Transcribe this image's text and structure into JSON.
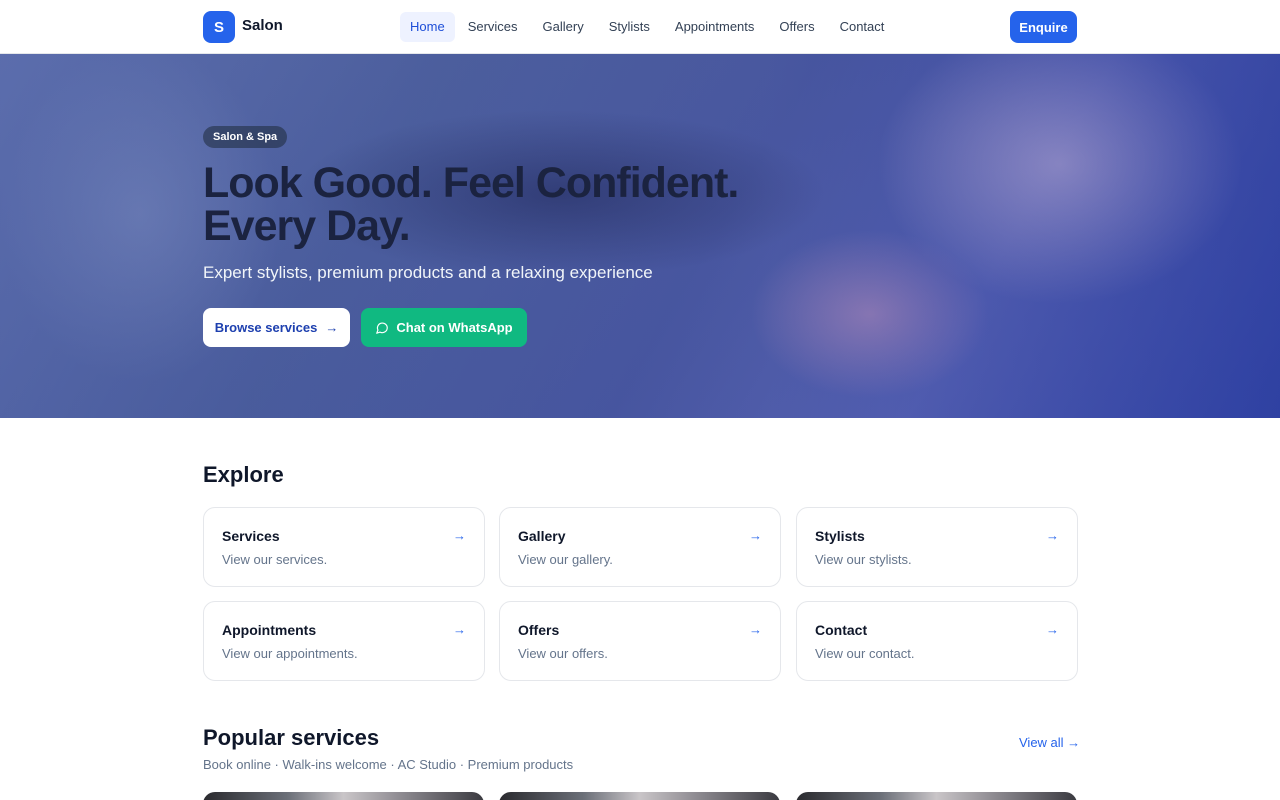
{
  "header": {
    "logo_letter": "S",
    "brand": "Salon",
    "nav": [
      "Home",
      "Services",
      "Gallery",
      "Stylists",
      "Appointments",
      "Offers",
      "Contact"
    ],
    "active_nav": "Home",
    "enquire_label": "Enquire"
  },
  "hero": {
    "tag": "Salon & Spa",
    "title_line1": "Look Good. Feel Confident.",
    "title_line2": "Every Day.",
    "subtitle": "Expert stylists, premium products and a relaxing experience",
    "browse_label": "Browse services",
    "whatsapp_label": "Chat on WhatsApp"
  },
  "explore": {
    "title": "Explore",
    "cards": [
      {
        "title": "Services",
        "desc": "View our services."
      },
      {
        "title": "Gallery",
        "desc": "View our gallery."
      },
      {
        "title": "Stylists",
        "desc": "View our stylists."
      },
      {
        "title": "Appointments",
        "desc": "View our appointments."
      },
      {
        "title": "Offers",
        "desc": "View our offers."
      },
      {
        "title": "Contact",
        "desc": "View our contact."
      }
    ]
  },
  "popular": {
    "title": "Popular services",
    "subtitle": "Book online · Walk-ins welcome · AC Studio · Premium products",
    "view_all": "View all →"
  },
  "colors": {
    "accent": "#2563eb",
    "whatsapp": "#10b981"
  }
}
